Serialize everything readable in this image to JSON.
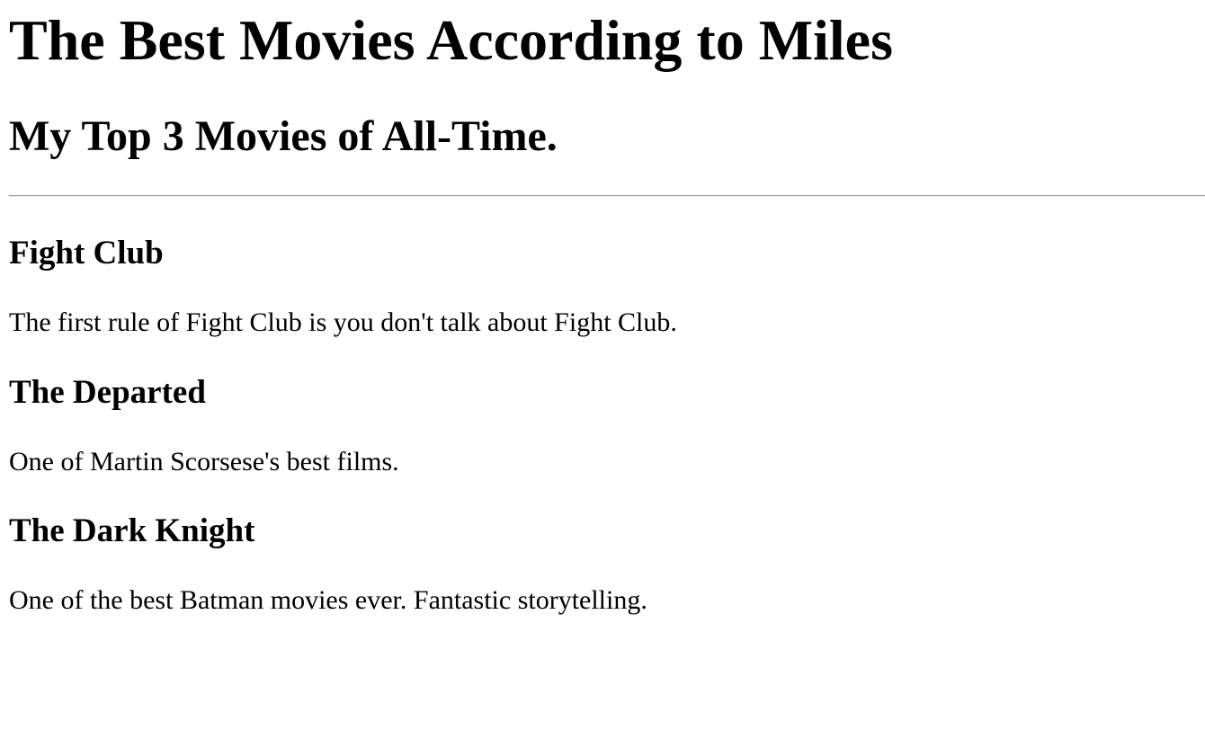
{
  "page": {
    "title": "The Best Movies According to Miles",
    "subtitle": "My Top 3 Movies of All-Time."
  },
  "movies": [
    {
      "title": "Fight Club",
      "description": "The first rule of Fight Club is you don't talk about Fight Club."
    },
    {
      "title": "The Departed",
      "description": "One of Martin Scorsese's best films."
    },
    {
      "title": "The Dark Knight",
      "description": "One of the best Batman movies ever. Fantastic storytelling."
    }
  ]
}
